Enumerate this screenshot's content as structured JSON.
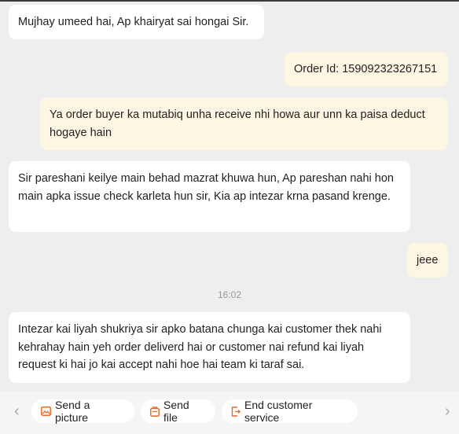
{
  "messages": [
    {
      "sender": "agent",
      "text": "Mujhay umeed hai, Ap khairyat sai hongai Sir."
    },
    {
      "sender": "user",
      "text": "Order Id: 159092323267151"
    },
    {
      "sender": "user",
      "text": "Ya order buyer ka mutabiq unha receive nhi howa aur unn ka paisa deduct hogaye hain"
    },
    {
      "sender": "agent",
      "text": "Sir pareshani keilye main behad mazrat khuwa hun, Ap pareshan nahi hon main apka issue check karleta hun sir, Kia ap intezar krna pasand krenge."
    },
    {
      "sender": "user",
      "text": "jeee"
    },
    {
      "sender": "agent",
      "text": "Intezar kai liyah shukriya sir apko batana chunga kai customer thek nahi kehrahay hain yeh order deliverd hai or customer nai refund kai liyah request ki hai jo kai accept nahi hoe hai team ki taraf sai."
    }
  ],
  "timestamp": "16:02",
  "toolbar": {
    "prev_icon": "chevron-left-icon",
    "next_icon": "chevron-right-icon",
    "actions": [
      {
        "label": "Send a picture",
        "icon": "picture-icon"
      },
      {
        "label": "Send file",
        "icon": "file-icon"
      },
      {
        "label": "End customer service",
        "icon": "exit-icon"
      }
    ]
  },
  "colors": {
    "agent_bubble": "#ffffff",
    "user_bubble": "#fdf6e3",
    "background": "#eeeeee",
    "icon_accent": "#f0641e"
  }
}
